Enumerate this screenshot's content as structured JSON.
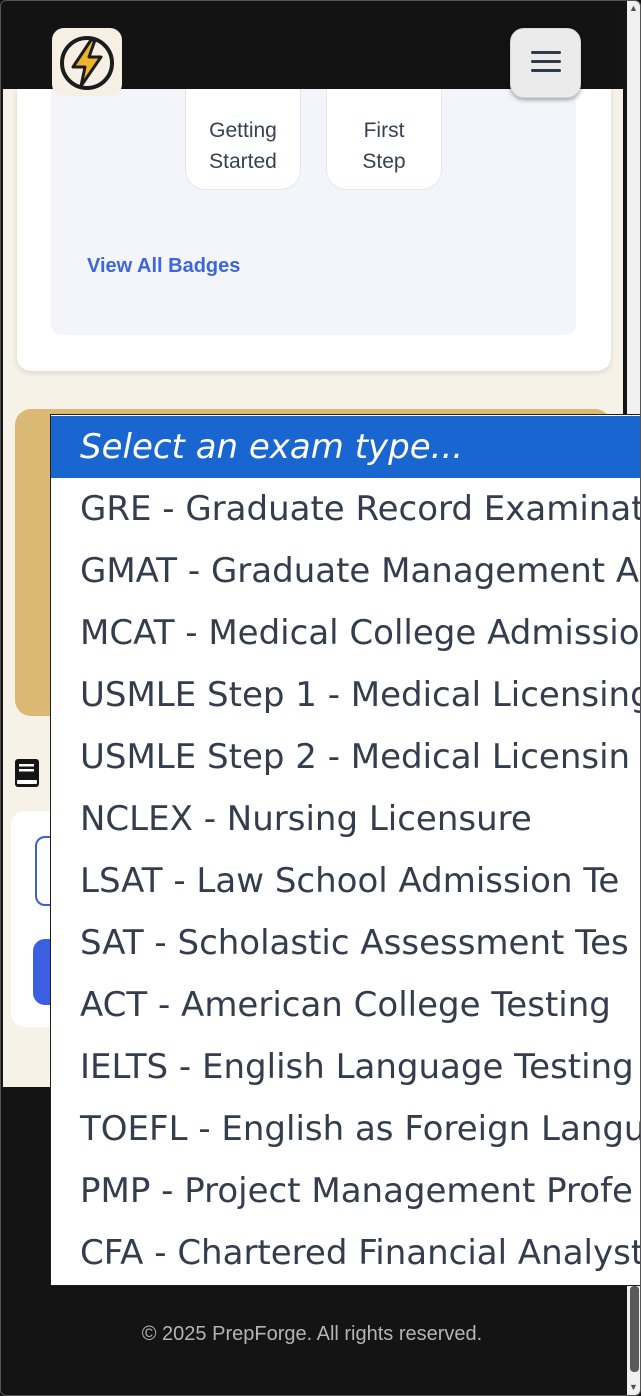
{
  "header": {
    "logo_alt": "lightning-bolt logo",
    "menu_icon": "hamburger-icon"
  },
  "badges": {
    "items": [
      {
        "line1": "Getting",
        "line2": "Started"
      },
      {
        "line1": "First",
        "line2": "Step"
      }
    ],
    "view_all_label": "View All Badges"
  },
  "exam_select": {
    "placeholder": "Select an exam type...",
    "options": [
      "GRE - Graduate Record Examinat",
      "GMAT - Graduate Management A",
      "MCAT - Medical College Admissio",
      "USMLE Step 1 - Medical Licensing",
      "USMLE Step 2 - Medical Licensin",
      "NCLEX - Nursing Licensure",
      "LSAT - Law School Admission Te",
      "SAT - Scholastic Assessment Tes",
      "ACT - American College Testing",
      "IELTS - English Language Testing",
      "TOEFL - English as Foreign Langu",
      "PMP - Project Management Profe",
      "CFA - Chartered Financial Analyst"
    ]
  },
  "footer": {
    "copyright": "© 2025 PrepForge. All rights reserved."
  },
  "colors": {
    "header_bg": "#131313",
    "accent_blue": "#1a66d1",
    "link_blue": "#3e66dc",
    "gold": "#dcb875"
  }
}
